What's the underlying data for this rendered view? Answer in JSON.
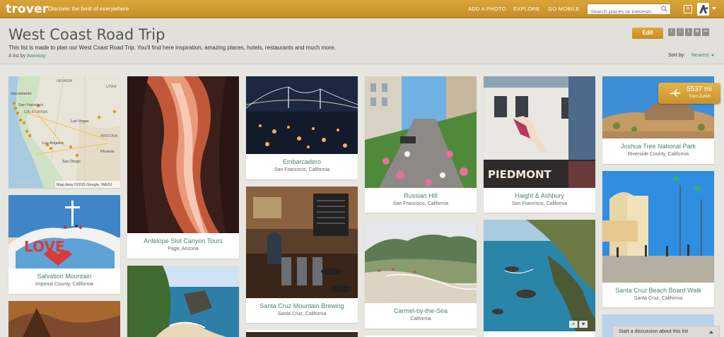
{
  "topbar": {
    "logo": "trover",
    "tagline": "Discover the best of everywhere",
    "nav": [
      "ADD A PHOTO",
      "EXPLORE",
      "GO MOBILE"
    ],
    "search_placeholder": "Search places or interests",
    "notifications": "0",
    "icons": [
      "search-icon",
      "avatar-icon",
      "chevron-down-icon"
    ]
  },
  "header": {
    "title": "West Coast Road Trip",
    "description": "This list is made to plan our West Coast Road Trip. You'll find here inspiration, amazing places, hotels, restaurants and much more.",
    "byline_prefix": "A list by",
    "author": "Awwway",
    "edit_label": "Edit",
    "share": [
      "f",
      "t",
      "t",
      "✉",
      "⚯"
    ],
    "sort_label": "Sort by:",
    "sort_value": "Nearest"
  },
  "map": {
    "attribution": "Map data ©2015 Google, INEGI",
    "google": "Google",
    "labels": [
      "NEVADA",
      "Sacramento",
      "San Francisco",
      "CALIFORNIA",
      "Las Vegas",
      "Los Angeles",
      "Phoenix",
      "San Diego",
      "ARIZONA",
      "UTAH"
    ]
  },
  "cards": [
    {
      "title": "Salvation Mountain",
      "sub": "Imperial County, California"
    },
    {
      "title": "Antelope Slot Canyon Tours",
      "sub": "Page, Arizona"
    },
    {
      "title": "Embarcadero",
      "sub": "San Francisco, California"
    },
    {
      "title": "Santa Cruz Mountain Brewing",
      "sub": "Santa Cruz, California"
    },
    {
      "title": "Russian Hill",
      "sub": "San Francisco, California"
    },
    {
      "title": "Carmel-by-the-Sea",
      "sub": "California"
    },
    {
      "title": "Haight & Ashbury",
      "sub": "San Francisco, California"
    },
    {
      "title": "Joshua Tree National Park",
      "sub": "Riverside County, California"
    },
    {
      "title": "Santa Cruz Beach Board Walk",
      "sub": "Santa Cruz, California"
    }
  ],
  "distance": {
    "value": "5537 mi",
    "from": "from Zurich"
  },
  "discussion": "Start a discussion about this list",
  "colors": {
    "brand": "#d29c33",
    "link": "#4a8566",
    "background": "#e7e6e1"
  }
}
